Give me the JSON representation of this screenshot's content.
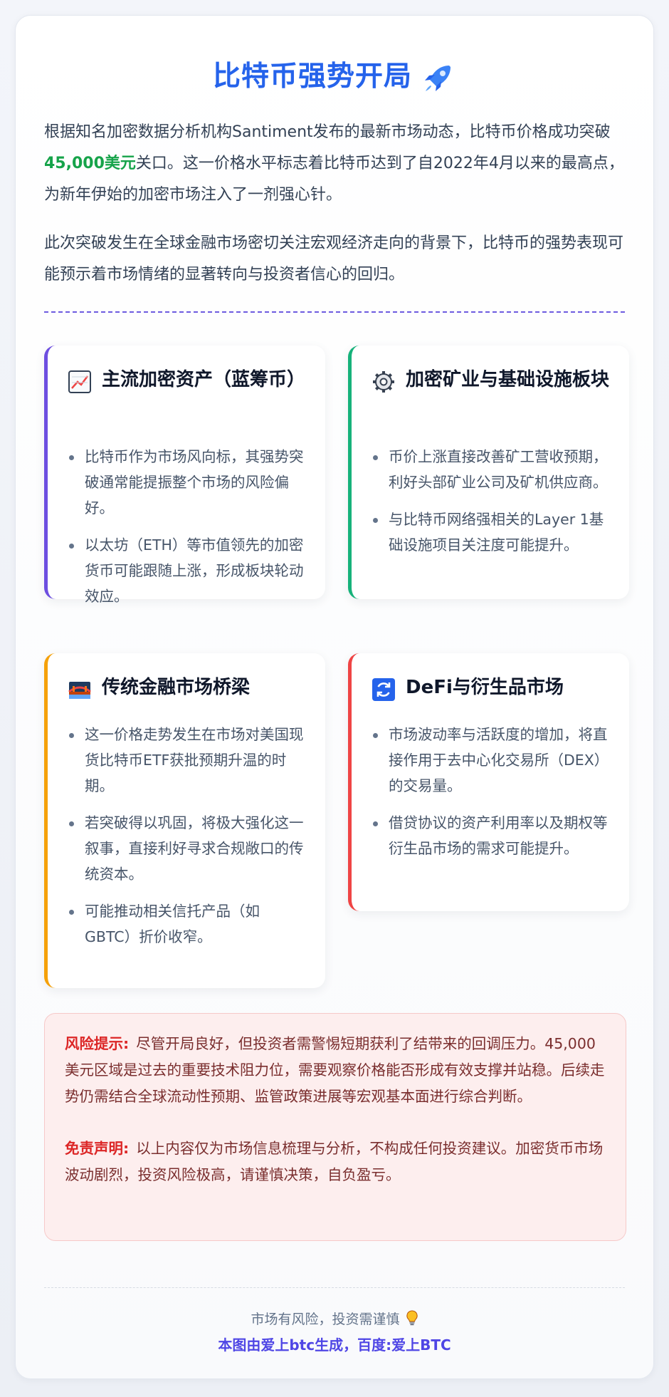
{
  "title": "比特币强势开局",
  "intro": {
    "p1_before": "根据知名加密数据分析机构Santiment发布的最新市场动态，比特币价格成功突破",
    "p1_highlight": "45,000美元",
    "p1_after": "关口。这一价格水平标志着比特币达到了自2022年4月以来的最高点，为新年伊始的加密市场注入了一剂强心针。",
    "p2": "此次突破发生在全球金融市场密切关注宏观经济走向的背景下，比特币的强势表现可能预示着市场情绪的显著转向与投资者信心的回归。"
  },
  "cards": [
    {
      "title": "主流加密资产（蓝筹币）",
      "icon": "chart-increasing-icon",
      "accent": "#6d4ee0",
      "items": [
        "比特币作为市场风向标，其强势突破通常能提振整个市场的风险偏好。",
        "以太坊（ETH）等市值领先的加密货币可能跟随上涨，形成板块轮动效应。"
      ]
    },
    {
      "title": "加密矿业与基础设施板块",
      "icon": "gear-icon",
      "accent": "#16b27a",
      "items": [
        "币价上涨直接改善矿工营收预期，利好头部矿业公司及矿机供应商。",
        "与比特币网络强相关的Layer 1基础设施项目关注度可能提升。"
      ]
    },
    {
      "title": "传统金融市场桥梁",
      "icon": "bridge-icon",
      "accent": "#f5a10a",
      "items": [
        "这一价格走势发生在市场对美国现货比特币ETF获批预期升温的时期。",
        "若突破得以巩固，将极大强化这一叙事，直接利好寻求合规敞口的传统资本。",
        "可能推动相关信托产品（如GBTC）折价收窄。"
      ]
    },
    {
      "title": "DeFi与衍生品市场",
      "icon": "refresh-icon",
      "accent": "#ef4444",
      "items": [
        "市场波动率与活跃度的增加，将直接作用于去中心化交易所（DEX）的交易量。",
        "借贷协议的资产利用率以及期权等衍生品市场的需求可能提升。"
      ]
    }
  ],
  "risk": {
    "label1": "风险提示:",
    "text1": "尽管开局良好，但投资者需警惕短期获利了结带来的回调压力。45,000美元区域是过去的重要技术阻力位，需要观察价格能否形成有效支撑并站稳。后续走势仍需结合全球流动性预期、监管政策进展等宏观基本面进行综合判断。",
    "label2": "免责声明:",
    "text2": "以上内容仅为市场信息梳理与分析，不构成任何投资建议。加密货币市场波动剧烈，投资风险极高，请谨慎决策，自负盈亏。"
  },
  "footer": {
    "line1": "市场有风险，投资需谨慎",
    "line1_icon": "light-bulb-icon",
    "line2": "本图由爱上btc生成，百度:爱上BTC"
  }
}
